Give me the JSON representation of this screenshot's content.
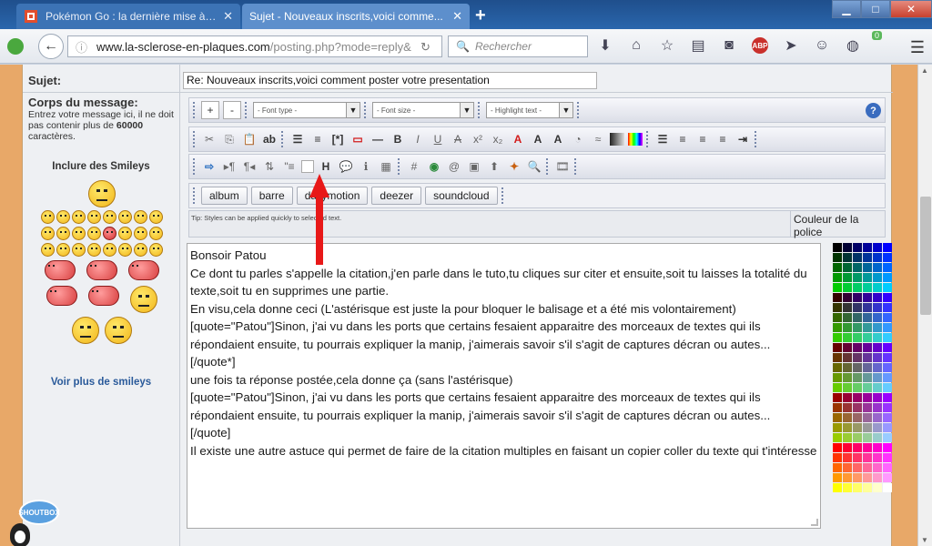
{
  "browser": {
    "tabs": [
      {
        "title": "Pokémon Go : la dernière mise à jo...",
        "active": false
      },
      {
        "title": "Sujet - Nouveaux inscrits,voici comme...",
        "active": true
      }
    ],
    "url_host": "www.la-sclerose-en-plaques.com",
    "url_path": "/posting.php?mode=reply&",
    "search_placeholder": "Rechercher",
    "abp_label": "ABP",
    "badge_count": "0"
  },
  "form": {
    "subject_label": "Sujet:",
    "subject_value": "Re: Nouveaux inscrits,voici comment poster votre presentation",
    "body_label": "Corps du message:",
    "body_help_prefix": "Entrez votre message ici, il ne doit pas contenir plus de ",
    "body_help_count": "60000",
    "body_help_suffix": " caractères.",
    "smileys_title": "Inclure des Smileys",
    "more_smileys": "Voir plus de smileys",
    "shoutbox_label": "SHOUTBOX"
  },
  "editor": {
    "add_label": "+",
    "remove_label": "-",
    "font_type": "- Font type -",
    "font_size": "- Font size -",
    "highlight": "- Highlight text -",
    "help_label": "?",
    "custom_buttons": [
      "album",
      "barre",
      "dailymotion",
      "deezer",
      "soundcloud"
    ],
    "tip": "Tip: Styles can be applied quickly to selected text.",
    "colour_label": "Couleur de la police"
  },
  "message_lines": [
    "Bonsoir Patou",
    "Ce dont tu parles s'appelle la citation,j'en parle dans le tuto,tu cliques sur citer et ensuite,soit tu laisses la totalité du texte,soit tu en supprimes une partie.",
    "En visu,cela donne ceci (L'astérisque est juste la pour bloquer le balisage et a été mis volontairement)",
    "[quote=\"Patou\"]Sinon, j'ai vu dans les ports que certains fesaient apparaitre des morceaux de textes qui ils répondaient ensuite, tu pourrais expliquer la manip, j'aimerais savoir s'il s'agit de captures décran ou autes...",
    "[/quote*]",
    "une fois ta réponse postée,cela donne ça (sans l'astérisque)",
    "[quote=\"Patou\"]Sinon, j'ai vu dans les ports que certains fesaient apparaitre des morceaux de textes qui ils répondaient ensuite, tu pourrais expliquer la manip, j'aimerais savoir s'il s'agit de captures décran ou autes...",
    "[/quote]",
    "Il existe une autre astuce qui permet de faire de la citation multiples en faisant un copier coller du texte qui t'intéresse"
  ],
  "colors": {
    "accent_arrow": "#e81818",
    "page_border": "#e8a868",
    "link": "#2a5a9a"
  }
}
